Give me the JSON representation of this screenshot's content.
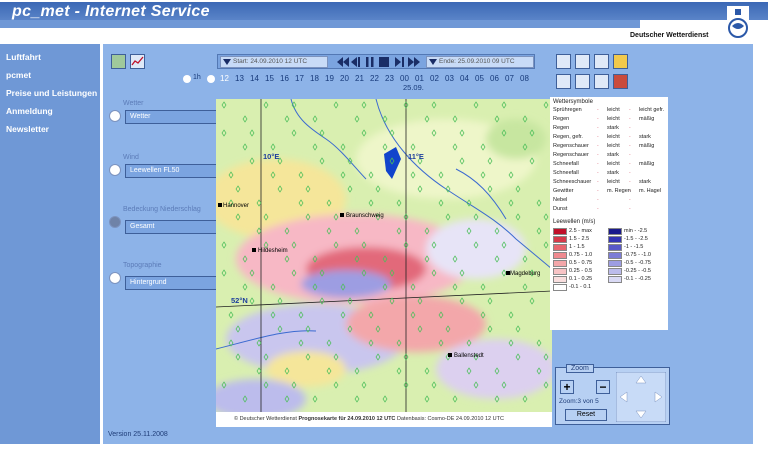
{
  "app": {
    "title": "pc_met - Internet Service",
    "org": "Deutscher Wetterdienst"
  },
  "nav": [
    {
      "label": "Luftfahrt"
    },
    {
      "label": "pcmet"
    },
    {
      "label": "Preise und Leistungen"
    },
    {
      "label": "Anmeldung"
    },
    {
      "label": "Newsletter"
    }
  ],
  "timebar": {
    "start": "Start: 24.09.2010 12 UTC",
    "end": "Ende: 25.09.2010 09 UTC",
    "step": "1h",
    "hours": [
      "12",
      "13",
      "14",
      "15",
      "16",
      "17",
      "18",
      "19",
      "20",
      "21",
      "22",
      "23",
      "00",
      "01",
      "02",
      "03",
      "04",
      "05",
      "06",
      "07",
      "08"
    ],
    "date_under": "25.09."
  },
  "layers": [
    {
      "label": "Wetter",
      "value": "Wetter"
    },
    {
      "label": "Wind",
      "value": "Leewellen FL50"
    },
    {
      "label": "Bedeckung  Niederschlag",
      "value": "Gesamt"
    },
    {
      "label": "Topographie",
      "value": "Hintergrund"
    }
  ],
  "map": {
    "grid_labels": {
      "lon10": "10°E",
      "lon11": "11°E",
      "lat52": "52°N"
    },
    "cities": [
      "Hannover",
      "Braunschweig",
      "Hildesheim",
      "Magdeburg",
      "Ballenstedt"
    ]
  },
  "legend": {
    "title": "Wettersymbole",
    "rows": [
      {
        "name": "Sprühregen",
        "a": "leicht",
        "b": "leicht gefr."
      },
      {
        "name": "Regen",
        "a": "leicht",
        "b": "mäßig"
      },
      {
        "name": "Regen",
        "a": "stark",
        "b": ""
      },
      {
        "name": "Regen, gefr.",
        "a": "leicht",
        "b": "stark"
      },
      {
        "name": "Regenschauer",
        "a": "leicht",
        "b": "mäßig"
      },
      {
        "name": "Regenschauer",
        "a": "stark",
        "b": ""
      },
      {
        "name": "Schneefall",
        "a": "leicht",
        "b": "mäßig"
      },
      {
        "name": "Schneefall",
        "a": "stark",
        "b": ""
      },
      {
        "name": "Schneeschauer",
        "a": "leicht",
        "b": "stark"
      },
      {
        "name": "Gewitter",
        "a": "m. Regen",
        "b": "m. Hagel"
      },
      {
        "name": "Nebel",
        "a": "",
        "b": ""
      },
      {
        "name": "Dunst",
        "a": "",
        "b": ""
      }
    ],
    "lee_title": "Leewellen (m/s)",
    "lee_up": [
      "2.5 - max",
      "1.5 - 2.5",
      "1 - 1.5",
      "0.75 - 1.0",
      "0.5 - 0.75",
      "0.25 - 0.5",
      "0.1 - 0.25",
      "-0.1 - 0.1"
    ],
    "lee_down": [
      "min - -2.5",
      "-1.5 - -2.5",
      "-1 - -1.5",
      "-0.75 - -1.0",
      "-0.5 - -0.75",
      "-0.25 - -0.5",
      "-0.1 - -0.25"
    ],
    "colors_up": [
      "#c0102a",
      "#d63a4a",
      "#e7666f",
      "#ef8a90",
      "#f3a7aa",
      "#f7c3c5",
      "#f9dede",
      "#ffffff"
    ],
    "colors_down": [
      "#1a1a8c",
      "#3434b4",
      "#5858c8",
      "#7c7cd6",
      "#9d9de2",
      "#bcbcec",
      "#dadaf5"
    ]
  },
  "zoom": {
    "title": "Zoom",
    "plus": "+",
    "minus": "−",
    "status": "Zoom:3 von 5",
    "reset": "Reset"
  },
  "footer": {
    "copyright": "© Deutscher Wetterdienst",
    "product": "Prognosekarte für",
    "valid": "24.09.2010 12 UTC",
    "base_label": "Datenbasis: Cosmo-DE 24.09.2010 12 UTC"
  },
  "version": "Version 25.11.2008"
}
